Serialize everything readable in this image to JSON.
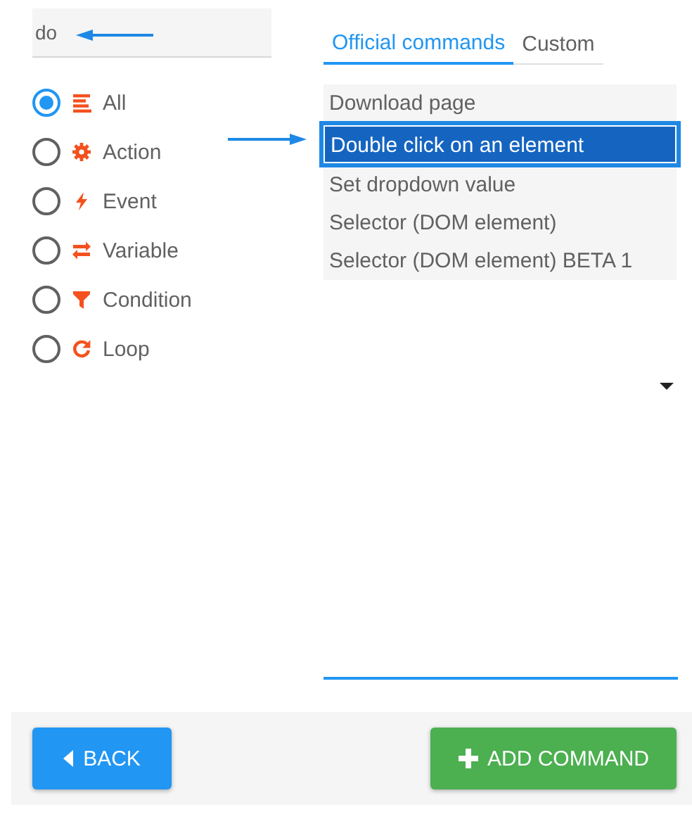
{
  "search": {
    "value": "do"
  },
  "filters": [
    {
      "label": "All",
      "kind": "all",
      "selected": true
    },
    {
      "label": "Action",
      "kind": "action",
      "selected": false
    },
    {
      "label": "Event",
      "kind": "event",
      "selected": false
    },
    {
      "label": "Variable",
      "kind": "variable",
      "selected": false
    },
    {
      "label": "Condition",
      "kind": "condition",
      "selected": false
    },
    {
      "label": "Loop",
      "kind": "loop",
      "selected": false
    }
  ],
  "tabs": [
    {
      "label": "Official commands",
      "selected": true
    },
    {
      "label": "Custom",
      "selected": false
    }
  ],
  "commands": [
    {
      "label": "Download page",
      "selected": false
    },
    {
      "label": "Double click on an element",
      "selected": true
    },
    {
      "label": "Set dropdown value",
      "selected": false
    },
    {
      "label": "Selector (DOM element)",
      "selected": false
    },
    {
      "label": "Selector (DOM element) BETA 1",
      "selected": false
    }
  ],
  "buttons": {
    "back": {
      "label": "BACK"
    },
    "add": {
      "label": "ADD COMMAND"
    }
  }
}
